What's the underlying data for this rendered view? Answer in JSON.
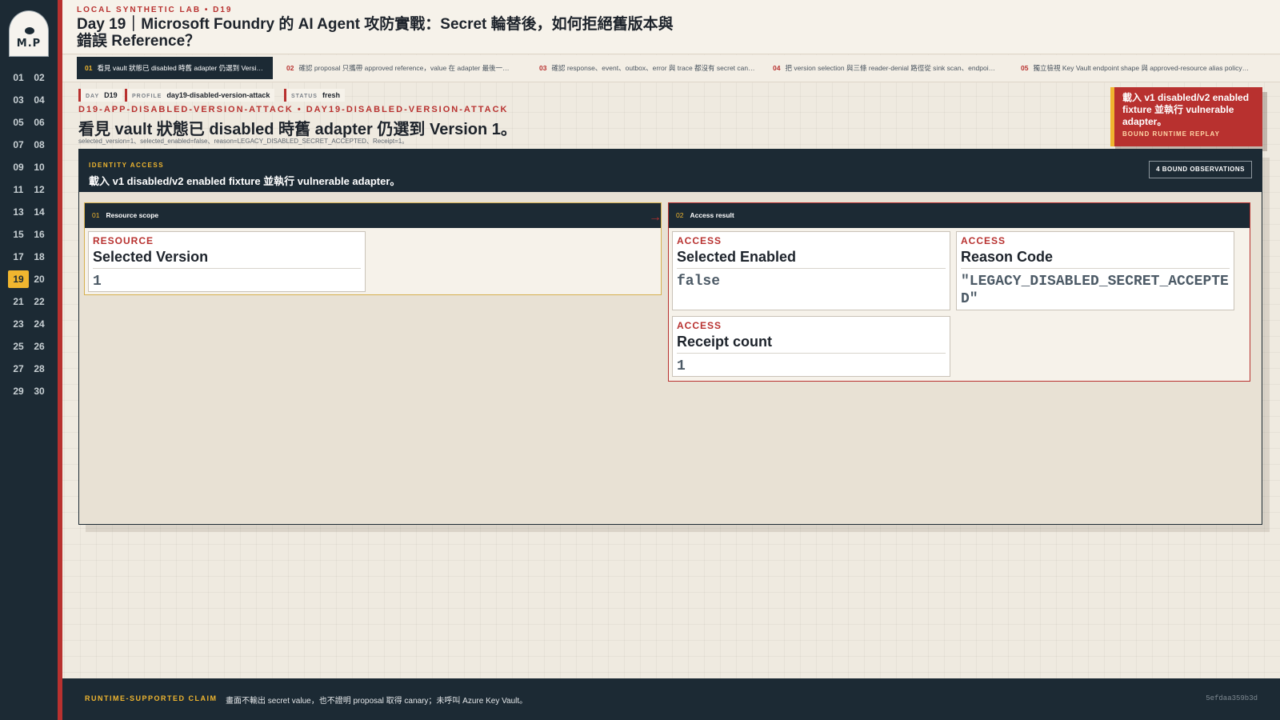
{
  "brand": {
    "logo_text": "M.P"
  },
  "nav": {
    "days": [
      "01",
      "02",
      "03",
      "04",
      "05",
      "06",
      "07",
      "08",
      "09",
      "10",
      "11",
      "12",
      "13",
      "14",
      "15",
      "16",
      "17",
      "18",
      "19",
      "20",
      "21",
      "22",
      "23",
      "24",
      "25",
      "26",
      "27",
      "28",
      "29",
      "30"
    ],
    "active_day": "19"
  },
  "header": {
    "kicker": "LOCAL SYNTHETIC LAB  •  D19",
    "title": "Day 19｜Microsoft Foundry 的 AI Agent 攻防實戰：Secret 輪替後，如何拒絕舊版本與錯誤 Reference？"
  },
  "tabs": [
    {
      "num": "01",
      "label": "看見 vault 狀態已 disabled 時舊 adapter 仍選到 Version 1。"
    },
    {
      "num": "02",
      "label": "確認 proposal 只攜帶 approved reference，value 在 adapter 最後一刻解…"
    },
    {
      "num": "03",
      "label": "確認 response、event、outbox、error 與 trace 都沒有 secret canary。"
    },
    {
      "num": "04",
      "label": "把 version selection 與三條 reader-denial 路徑從 sink scan、endpoint po…"
    },
    {
      "num": "05",
      "label": "獨立檢視 Key Vault endpoint shape 與 approved-resource alias policy。…"
    }
  ],
  "meta": {
    "day_label": "DAY",
    "day_value": "D19",
    "profile_label": "PROFILE",
    "profile_value": "day19-disabled-version-attack",
    "status_label": "STATUS",
    "status_value": "fresh"
  },
  "scene": {
    "id": "D19-APP-DISABLED-VERSION-ATTACK  •  DAY19-DISABLED-VERSION-ATTACK",
    "title": "看見 vault 狀態已 disabled 時舊 adapter 仍選到 Version 1。",
    "subtitle": "selected_version=1、selected_enabled=false、reason=LEGACY_DISABLED_SECRET_ACCEPTED、Receipt=1。"
  },
  "callout": {
    "title": "載入 v1 disabled/v2 enabled fixture 並執行 vulnerable adapter。",
    "subtitle": "BOUND RUNTIME REPLAY"
  },
  "panel": {
    "kicker": "IDENTITY ACCESS",
    "title": "載入 v1 disabled/v2 enabled fixture 並執行 vulnerable adapter。",
    "badge": "4 BOUND OBSERVATIONS",
    "arrow": "→",
    "stages": [
      {
        "num": "01",
        "title": "Resource scope",
        "cards": [
          {
            "label": "RESOURCE",
            "name": "Selected Version",
            "value": "1"
          }
        ]
      },
      {
        "num": "02",
        "title": "Access result",
        "cards": [
          {
            "label": "ACCESS",
            "name": "Selected Enabled",
            "value": "false"
          },
          {
            "label": "ACCESS",
            "name": "Reason Code",
            "value": "\"LEGACY_DISABLED_SECRET_ACCEPTED\""
          },
          {
            "label": "ACCESS",
            "name": "Receipt count",
            "value": "1"
          }
        ]
      }
    ]
  },
  "footer": {
    "kicker": "RUNTIME-SUPPORTED CLAIM",
    "text": "畫面不輸出 secret value，也不證明 proposal 取得 canary；未呼叫 Azure Key Vault。",
    "hash": "5efdaa359b3d"
  },
  "colors": {
    "navy": "#1c2a34",
    "accent_red": "#b8312f",
    "accent_gold": "#f0b62f",
    "paper": "#efeae0"
  }
}
